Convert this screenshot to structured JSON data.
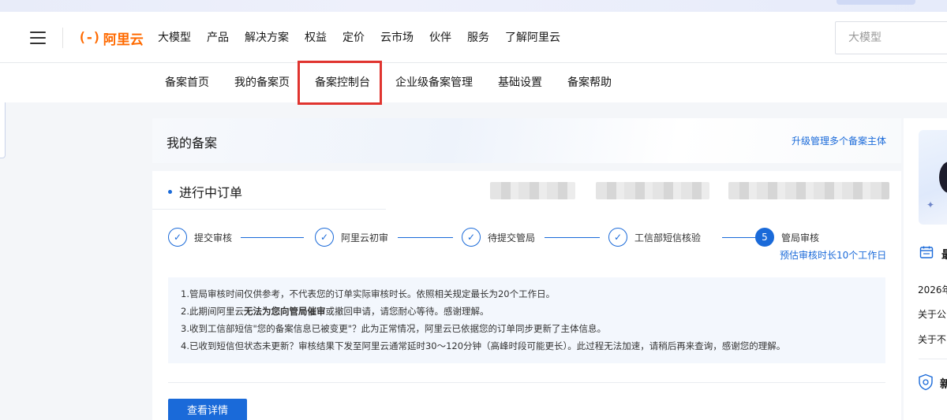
{
  "header": {
    "logo_mark": "(-)",
    "logo_text": "阿里云",
    "nav": [
      "大模型",
      "产品",
      "解决方案",
      "权益",
      "定价",
      "云市场",
      "伙伴",
      "服务",
      "了解阿里云"
    ],
    "search_placeholder": "大模型"
  },
  "subnav": {
    "items": [
      "备案首页",
      "我的备案页",
      "备案控制台",
      "企业级备案管理",
      "基础设置",
      "备案帮助"
    ],
    "highlighted": "备案控制台"
  },
  "card": {
    "title": "我的备案",
    "link": "升级管理多个备案主体"
  },
  "order": {
    "title": "进行中订单",
    "steps": [
      {
        "label": "提交审核",
        "state": "done"
      },
      {
        "label": "阿里云初审",
        "state": "done"
      },
      {
        "label": "待提交管局",
        "state": "done"
      },
      {
        "label": "工信部短信核验",
        "state": "done"
      },
      {
        "label": "管局审核",
        "state": "active",
        "number": "5"
      }
    ],
    "current_sub": "预估审核时长10个工作日",
    "notice": [
      {
        "pre": "1.管局审核时间仅供参考，不代表您的订单实际审核时长。依照相关规定最长为20个工作日。",
        "bold": "",
        "post": ""
      },
      {
        "pre": "2.此期间阿里云",
        "bold": "无法为您向管局催审",
        "post": "或撤回申请，请您耐心等待。感谢理解。"
      },
      {
        "pre": "3.收到工信部短信\"您的备案信息已被变更\"？此为正常情况，阿里云已依据您的订单同步更新了主体信息。",
        "bold": "",
        "post": ""
      },
      {
        "pre": "4.已收到短信但状态未更新？审核结果下发至阿里云通常延时30～120分钟（高峰时段可能更长）。此过程无法加速，请稍后再来查询，感谢您的理解。",
        "bold": "",
        "post": ""
      }
    ],
    "detail_button": "查看详情"
  },
  "side": {
    "heading_fragment": "最",
    "lines": [
      "2026年",
      "关于公",
      "关于不"
    ],
    "shield_fragment": "新"
  },
  "colors": {
    "brand": "#ff6a00",
    "accent": "#1a6ad9",
    "highlight": "#e0342f"
  }
}
